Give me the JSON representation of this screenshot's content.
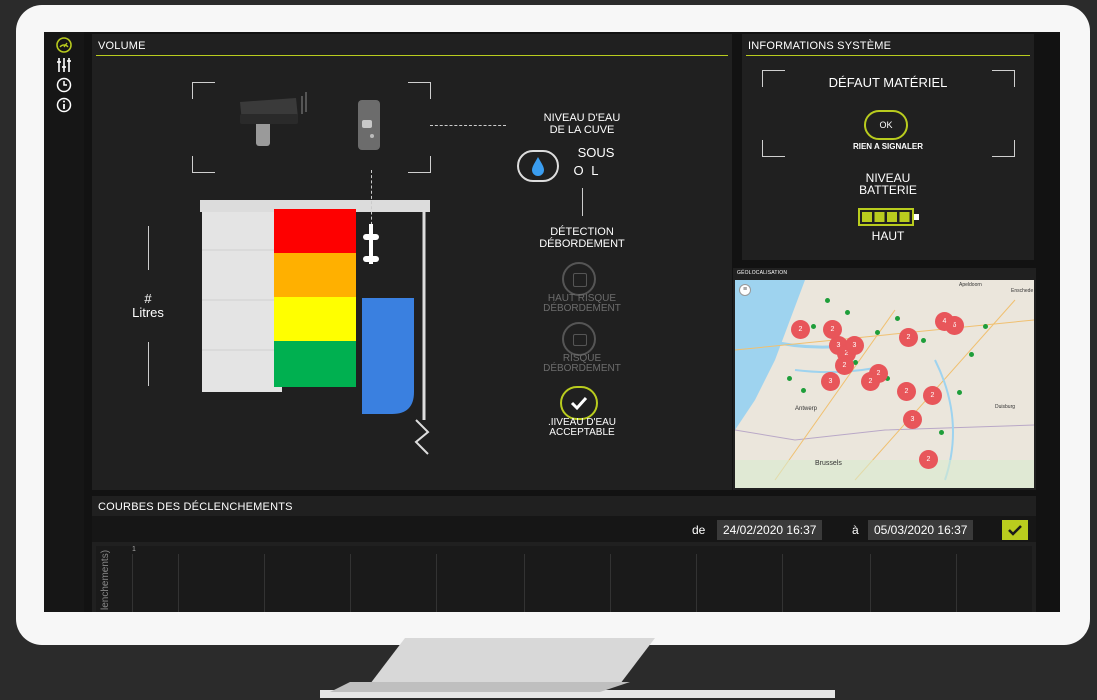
{
  "volume": {
    "title": "VOLUME",
    "quantity_symbol": "#",
    "unit_label": "Litres",
    "water_level": {
      "line1": "NIVEAU D'EAU",
      "line2": "DE LA CUVE",
      "value_top": "SOUS",
      "value_bottom": "O L"
    },
    "detection_title": {
      "line1": "DÉTECTION",
      "line2": "DÉBORDEMENT"
    },
    "status_high_risk": {
      "line1": "HAUT RISQUE",
      "line2": "DÉBORDEMENT"
    },
    "status_risk": {
      "line1": "RISQUE",
      "line2": "DÉBORDEMENT"
    },
    "status_acceptable": {
      "line1": ".IIVEAU D'EAU",
      "line2": "ACCEPTABLE"
    },
    "colors": {
      "red": "#fe0000",
      "orange": "#ffb000",
      "yellow": "#ffff00",
      "green": "#00b050",
      "water": "#3a80e0"
    }
  },
  "system_info": {
    "title": "INFORMATIONS SYSTÈME",
    "fault_title": "DÉFAUT MATÉRIEL",
    "ok_label": "OK",
    "nothing_to_report": "RIEN A SIGNALER",
    "battery_title_line1": "NIVEAU",
    "battery_title_line2": "BATTERIE",
    "battery_value": "HAUT",
    "battery_bars_filled": 4,
    "accent": "#b9cc1e"
  },
  "geolocation": {
    "title": "GÉOLOCALISATION",
    "city_labels": [
      "Apeldoorn",
      "Enschede",
      "Antwerp",
      "Brussels",
      "Duisburg"
    ],
    "clusters": [
      "6",
      "2",
      "2",
      "3",
      "2",
      "3",
      "2",
      "2",
      "3",
      "2",
      "2",
      "2",
      "3",
      "2",
      "4",
      "2"
    ]
  },
  "curves": {
    "title": "COURBES DES DÉCLENCHEMENTS",
    "from_label": "de",
    "from_value": "24/02/2020 16:37",
    "to_label": "à",
    "to_value": "05/03/2020 16:37",
    "y_axis_label": "lenchements)",
    "y_tick": "1"
  }
}
